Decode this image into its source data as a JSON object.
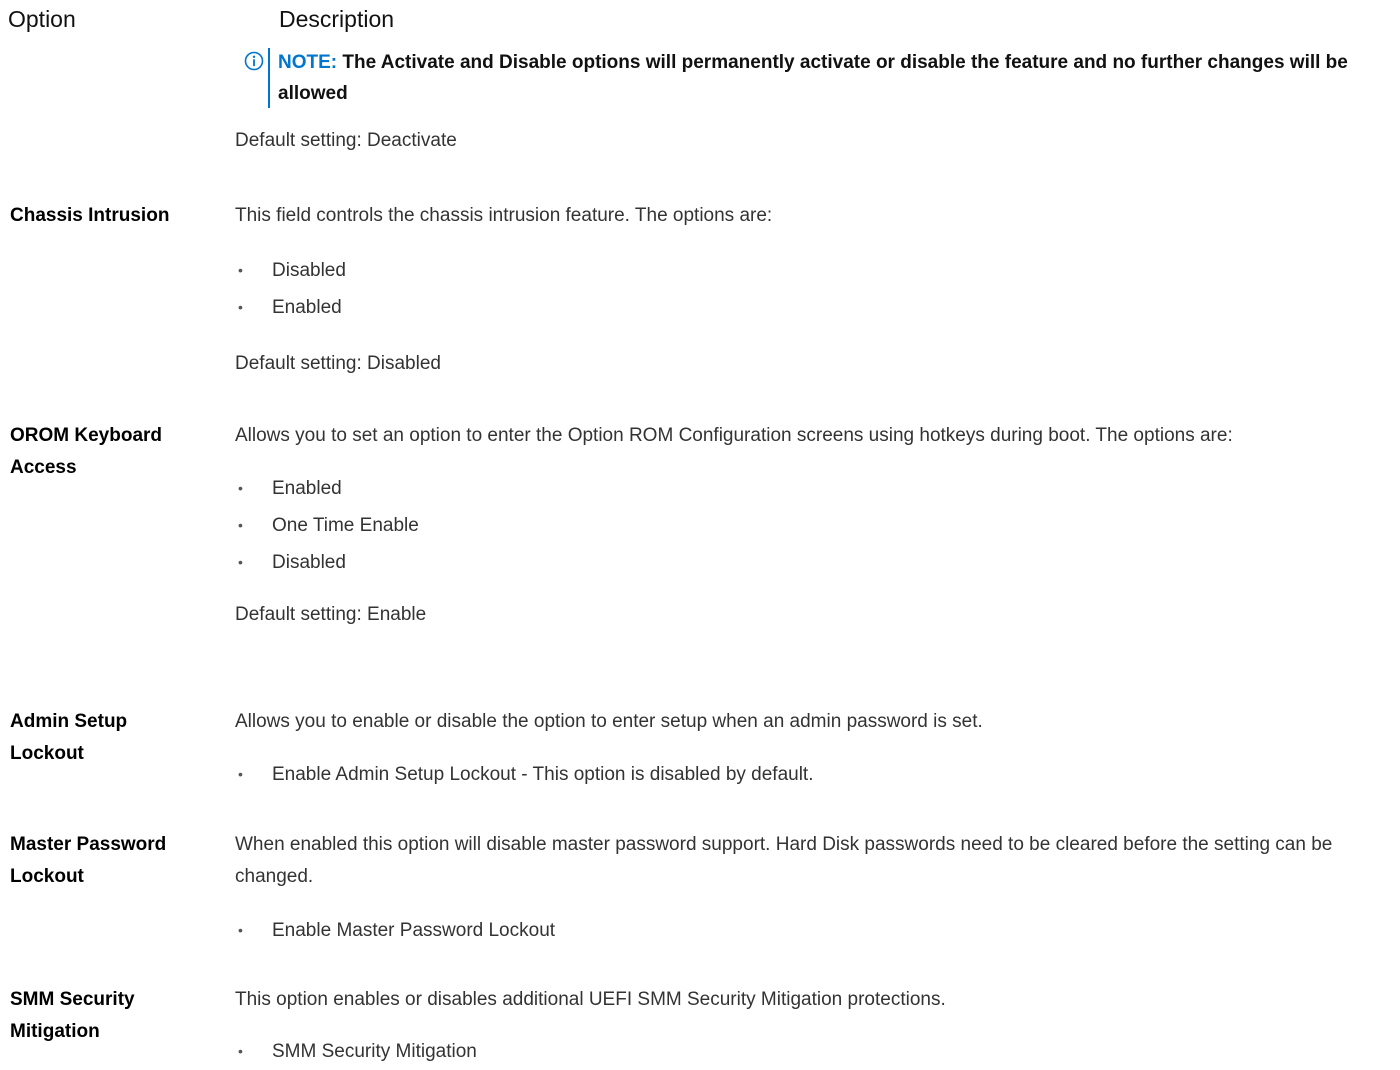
{
  "header": {
    "option": "Option",
    "description": "Description"
  },
  "note": {
    "label": "NOTE:",
    "text": "The Activate and Disable options will permanently activate or disable the feature and no further changes will be allowed"
  },
  "intro_default": "Default setting: Deactivate",
  "rows": [
    {
      "option": "Chassis Intrusion",
      "description": "This field controls the chassis intrusion feature. The options are:",
      "bullets": [
        "Disabled",
        "Enabled"
      ],
      "default": "Default setting: Disabled"
    },
    {
      "option": "OROM Keyboard Access",
      "description": "Allows you to set an option to enter the Option ROM Configuration screens using hotkeys during boot. The options are:",
      "bullets": [
        "Enabled",
        "One Time Enable",
        "Disabled"
      ],
      "default": "Default setting: Enable"
    },
    {
      "option": "Admin Setup Lockout",
      "description": "Allows you to enable or disable the option to enter setup when an admin password is set.",
      "bullets": [
        "Enable Admin Setup Lockout - This option is disabled by default."
      ]
    },
    {
      "option": "Master Password Lockout",
      "description": "When enabled this option will disable master password support. Hard Disk passwords need to be cleared before the setting can be changed.",
      "bullets": [
        "Enable Master Password Lockout"
      ]
    },
    {
      "option": "SMM Security Mitigation",
      "description": "This option enables or disables additional UEFI SMM Security Mitigation protections.",
      "bullets": [
        "SMM Security Mitigation"
      ]
    }
  ],
  "icons": {
    "note": "info-circle-icon",
    "bullet": "bullet-dot-icon"
  },
  "colors": {
    "accent": "#0076ce"
  }
}
